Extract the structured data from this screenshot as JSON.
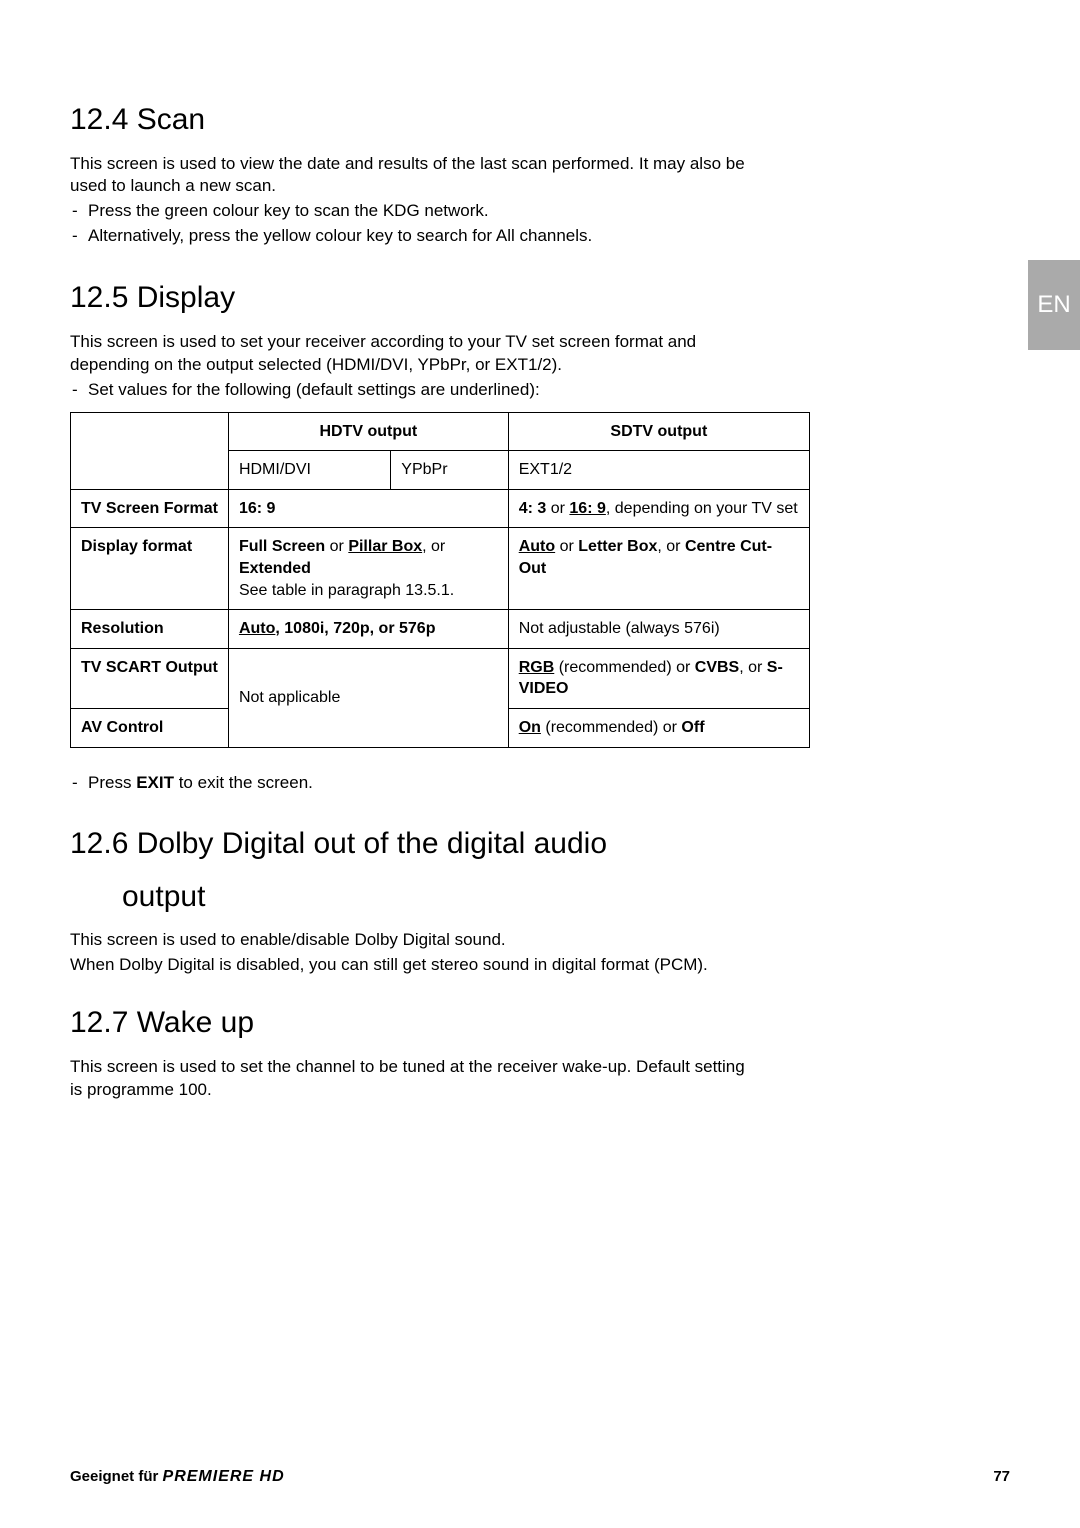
{
  "langtab": "EN",
  "sections": {
    "scan": {
      "heading": "12.4 Scan",
      "p1": "This screen is used to view the date and results of the last scan performed. It may also be used to launch a new scan.",
      "b1": "Press the green colour key to scan the KDG network.",
      "b2": "Alternatively, press the yellow colour key to search for All channels."
    },
    "display": {
      "heading": "12.5 Display",
      "p1": "This screen is used to set your receiver according to your TV set screen format and depending on the output selected (HDMI/DVI, YPbPr, or EXT1/2).",
      "b1": "Set values for the following (default settings are underlined):",
      "exit_pre": "Press ",
      "exit_bold": "EXIT",
      "exit_post": " to exit the screen."
    },
    "dolby": {
      "heading": "12.6 Dolby Digital out of the digital audio",
      "heading2": "output",
      "p1": "This screen is used to enable/disable Dolby Digital sound.",
      "p2": "When Dolby Digital is disabled, you can still get stereo sound in digital format (PCM)."
    },
    "wake": {
      "heading": "12.7 Wake up",
      "p1": "This screen is used to set the channel to be tuned at the receiver wake-up. Default setting is programme 100."
    }
  },
  "table": {
    "hdtv": "HDTV output",
    "sdtv": "SDTV output",
    "hdmidvi": "HDMI/DVI",
    "ypbpr": "YPbPr",
    "ext12": "EXT1/2",
    "row1label": "TV Screen Format",
    "row1_hd": "16: 9",
    "row1_sd_a": "4: 3",
    "row1_sd_b": " or ",
    "row1_sd_c": "16: 9",
    "row1_sd_d": ", depending on your TV set",
    "row2label": "Display format",
    "row2_hd_a": "Full Screen",
    "row2_hd_b": " or ",
    "row2_hd_c": "Pillar Box",
    "row2_hd_d": ", or ",
    "row2_hd_e": "Extended",
    "row2_hd_f": "See table in paragraph 13.5.1.",
    "row2_sd_a": "Auto",
    "row2_sd_b": " or ",
    "row2_sd_c": "Letter Box",
    "row2_sd_d": ", or ",
    "row2_sd_e": "Centre Cut-Out",
    "row3label": "Resolution",
    "row3_hd_a": "Auto",
    "row3_hd_b": ", 1080i, 720p, or 576p",
    "row3_sd": "Not adjustable (always 576i)",
    "row4label": "TV SCART Output",
    "row4_hd": "Not applicable",
    "row4_sd_a": "RGB",
    "row4_sd_b": " (recommended) or ",
    "row4_sd_c": "CVBS",
    "row4_sd_d": ", or ",
    "row4_sd_e": "S-VIDEO",
    "row5label": "AV Control",
    "row5_sd_a": "On",
    "row5_sd_b": " (recommended) or ",
    "row5_sd_c": "Off"
  },
  "footer": {
    "pre": "Geeignet für ",
    "brand": "PREMIERE HD",
    "page": "77"
  }
}
